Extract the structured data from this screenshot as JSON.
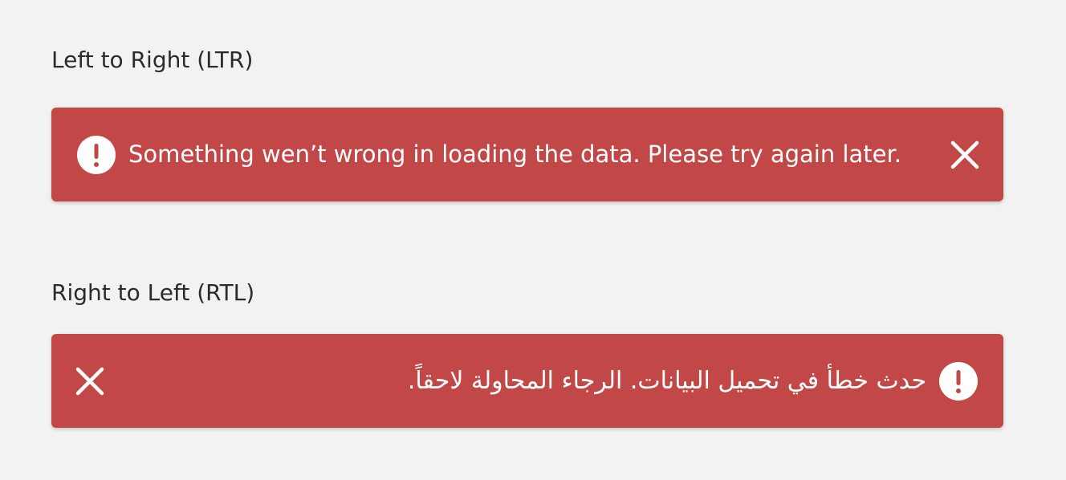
{
  "colors": {
    "background": "#f2f2f2",
    "alert_bg": "#c24848",
    "alert_text": "#ffffff",
    "title_text": "#2b2b2b"
  },
  "ltr": {
    "title": "Left to Right (LTR)",
    "alert": {
      "icon": "exclamation-circle-icon",
      "message": "Something wen’t wrong in loading the data. Please try again later.",
      "close_icon": "close-icon"
    }
  },
  "rtl": {
    "title": "Right to Left (RTL)",
    "alert": {
      "icon": "exclamation-circle-icon",
      "message": "حدث خطأ في تحميل البيانات. الرجاء المحاولة لاحقاً.",
      "close_icon": "close-icon"
    }
  }
}
